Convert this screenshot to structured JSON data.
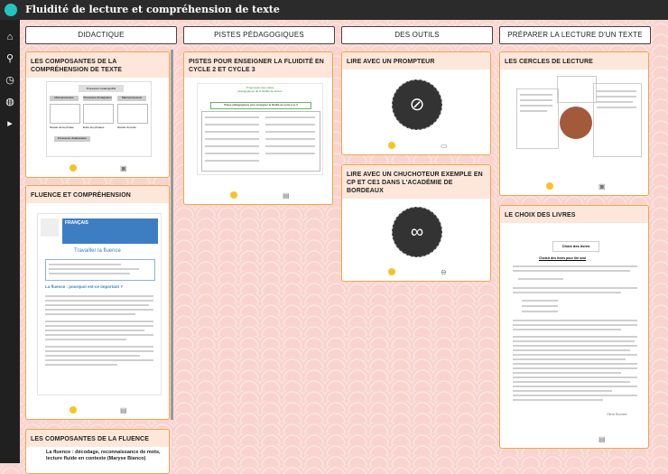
{
  "app": {
    "title": "Fluidité de lecture et compréhension de texte"
  },
  "sidebar": {
    "icons": [
      "home-icon",
      "search-icon",
      "clock-icon",
      "globe-icon",
      "play-icon"
    ]
  },
  "columns": [
    {
      "label": "DIDACTIQUE"
    },
    {
      "label": "PISTES PÉDAGOGIQUES"
    },
    {
      "label": "DES OUTILS"
    },
    {
      "label": "PRÉPARER LA LECTURE D'UN TEXTE"
    }
  ],
  "cards": {
    "c1": {
      "title": "LES COMPOSANTES DE LA COMPRÉHENSION DE TEXTE",
      "thumb_title": "Processus métacognitifs",
      "labels": [
        "Microprocessus",
        "Processus d'intégration",
        "Macroprocessus",
        "Niveau de la phrase",
        "Entre les phrases",
        "Niveau du texte",
        "Processus d'élaboration"
      ]
    },
    "c2": {
      "title": "FLUENCE ET COMPRÉHENSION",
      "thumb_heading": "FRANÇAIS",
      "thumb_sub": "Travailler la fluence",
      "thumb_section": "La fluence : pourquoi est-ce important ?"
    },
    "c3": {
      "title": "LES COMPOSANTES DE LA FLUENCE",
      "subtitle": "La fluence : décodage, reconnaissance de mots, lecture fluide en contexte (Maryse Bianco)"
    },
    "c4": {
      "title": "PISTES POUR ENSEIGNER LA FLUIDITÉ EN CYCLE 2 ET CYCLE 3",
      "thumb_heading": "Progression des pistes pédagogiques de la fluidité de lecture",
      "thumb_sub": "Pistes pédagogiques pour enseigner la fluidité au cycle 2 et 3"
    },
    "c5": {
      "title": "LIRE AVEC UN PROMPTEUR"
    },
    "c6": {
      "title": "LIRE AVEC UN CHUCHOTEUR EXEMPLE EN CP ET CE1 DANS L'ACADÉMIE DE BORDEAUX"
    },
    "c7": {
      "title": "LES CERCLES DE LECTURE"
    },
    "c8": {
      "title": "LE CHOIX DES LIVRES",
      "thumb_heading": "Choix des livres",
      "thumb_sub": "Choisir des livres pour lire seul",
      "signature": "Olivia Roussel"
    }
  }
}
